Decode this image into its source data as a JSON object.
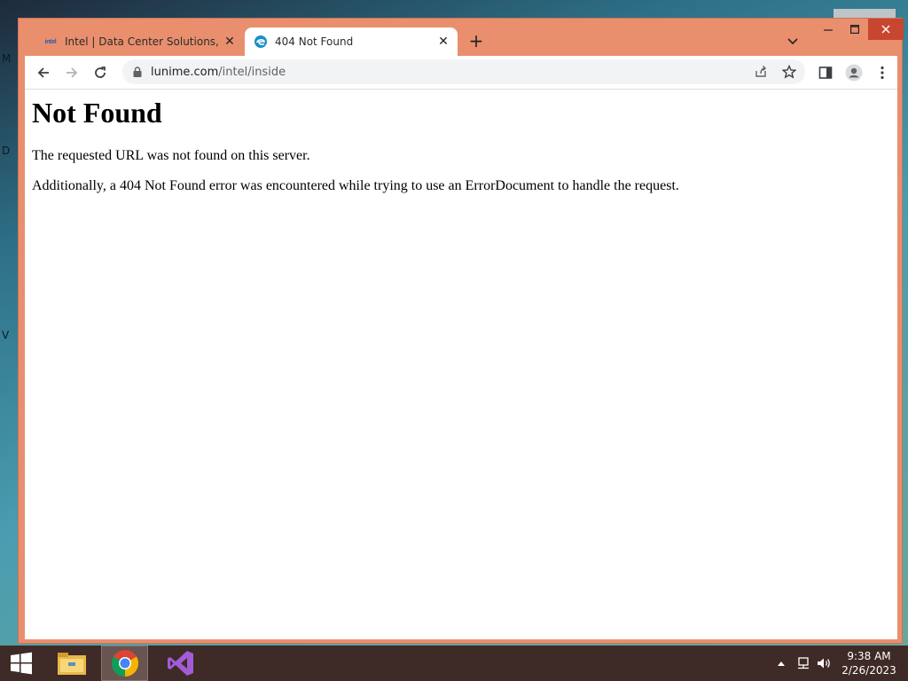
{
  "desktop": {
    "edge_letters": [
      "M",
      "D",
      "V"
    ]
  },
  "browser": {
    "tabs": [
      {
        "title": "Intel | Data Center Solutions, IoT",
        "favicon": "intel-logo",
        "active": false
      },
      {
        "title": "404 Not Found",
        "favicon": "edge-globe-icon",
        "active": true
      }
    ],
    "address": {
      "host": "lunime.com",
      "path": "/intel/inside"
    },
    "colors": {
      "frame": "#e98f6e",
      "close_button": "#c8462f"
    }
  },
  "page": {
    "heading": "Not Found",
    "paragraph1": "The requested URL was not found on this server.",
    "paragraph2": "Additionally, a 404 Not Found error was encountered while trying to use an ErrorDocument to handle the request."
  },
  "taskbar": {
    "items": [
      "start-icon",
      "file-explorer-icon",
      "chrome-icon",
      "visual-studio-icon"
    ],
    "clock": {
      "time": "9:38 AM",
      "date": "2/26/2023"
    }
  }
}
